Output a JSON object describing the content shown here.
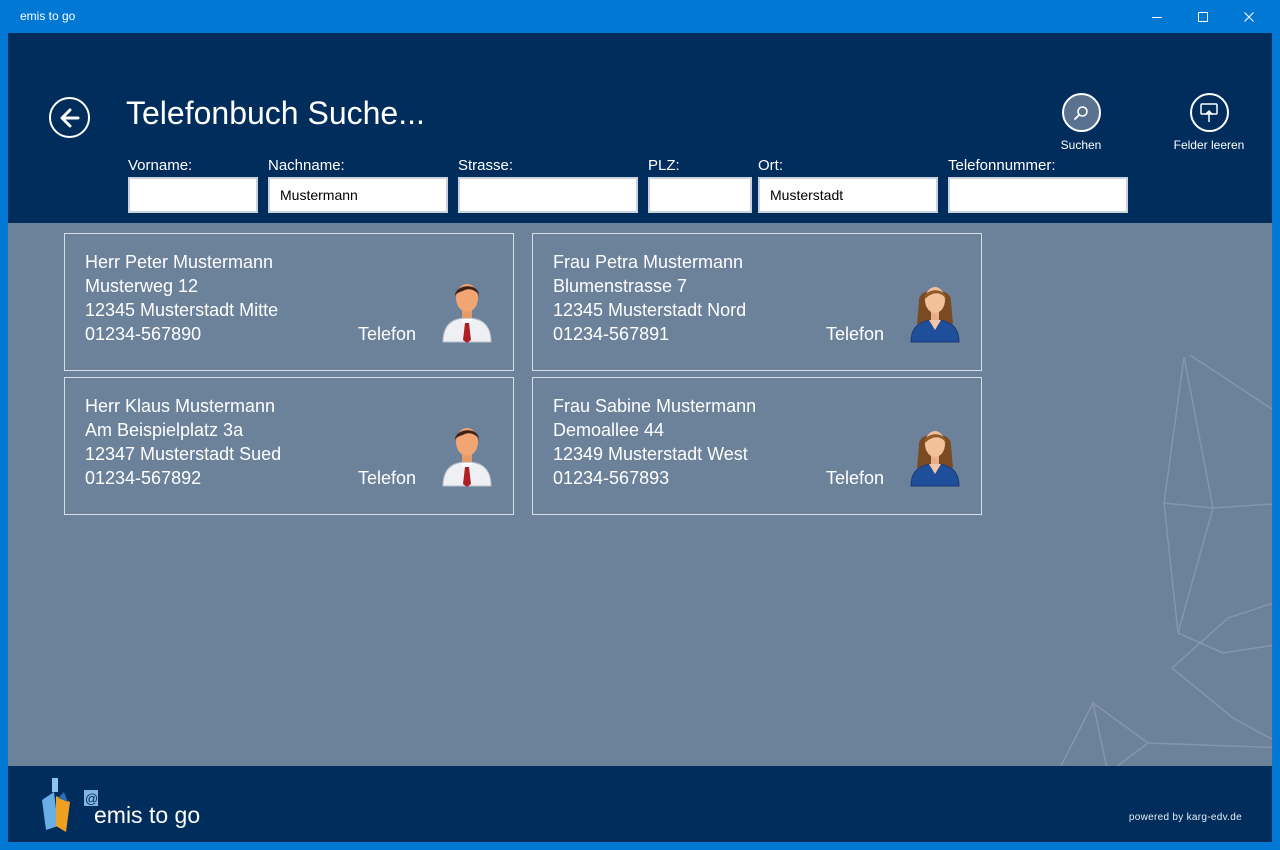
{
  "window": {
    "title": "emis to go"
  },
  "header": {
    "title": "Telefonbuch Suche..."
  },
  "actions": {
    "search_label": "Suchen",
    "clear_label": "Felder leeren"
  },
  "fields": {
    "vorname": {
      "label": "Vorname:",
      "value": ""
    },
    "nachname": {
      "label": "Nachname:",
      "value": "Mustermann"
    },
    "strasse": {
      "label": "Strasse:",
      "value": ""
    },
    "plz": {
      "label": "PLZ:",
      "value": ""
    },
    "ort": {
      "label": "Ort:",
      "value": "Musterstadt"
    },
    "telefon": {
      "label": "Telefonnummer:",
      "value": ""
    }
  },
  "results": [
    {
      "name": "Herr Peter Mustermann",
      "street": "Musterweg 12",
      "city": "12345 Musterstadt Mitte",
      "phone": "01234-567890",
      "phone_label": "Telefon",
      "avatar": "male-avatar-icon"
    },
    {
      "name": "Frau Petra Mustermann",
      "street": "Blumenstrasse 7",
      "city": "12345 Musterstadt Nord",
      "phone": "01234-567891",
      "phone_label": "Telefon",
      "avatar": "female-avatar-icon"
    },
    {
      "name": "Herr Klaus Mustermann",
      "street": "Am Beispielplatz 3a",
      "city": "12347 Musterstadt Sued",
      "phone": "01234-567892",
      "phone_label": "Telefon",
      "avatar": "male-avatar-icon"
    },
    {
      "name": "Frau Sabine Mustermann",
      "street": "Demoallee 44",
      "city": "12349 Musterstadt West",
      "phone": "01234-567893",
      "phone_label": "Telefon",
      "avatar": "female-avatar-icon"
    }
  ],
  "footer": {
    "logo_text": "emis to go",
    "logo_at": "@",
    "powered_by": "powered by karg-edv.de"
  },
  "colors": {
    "titlebar": "#0078d4",
    "header": "#002d5c",
    "content": "#6c819a"
  }
}
